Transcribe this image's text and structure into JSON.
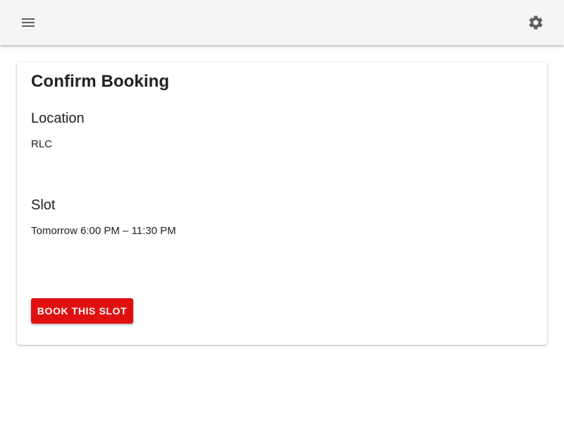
{
  "app_bar": {
    "background": "#f5f5f5",
    "menu_icon": "menu-icon",
    "settings_icon": "gear-icon"
  },
  "card": {
    "title": "Confirm Booking",
    "location": {
      "heading": "Location",
      "value": "RLC"
    },
    "slot": {
      "heading": "Slot",
      "value": "Tomorrow 6:00 PM – 11:30 PM"
    },
    "book_button_label": "BOOK THIS SLOT",
    "accent_color": "#e01010"
  }
}
